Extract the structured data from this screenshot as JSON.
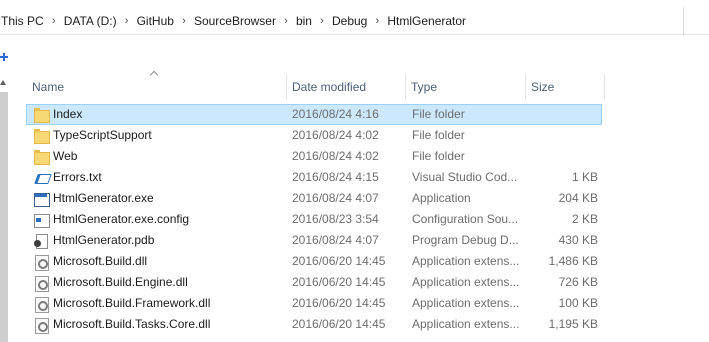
{
  "address_bar": {
    "crumbs": [
      "This PC",
      "DATA (D:)",
      "GitHub",
      "SourceBrowser",
      "bin",
      "Debug",
      "HtmlGenerator"
    ]
  },
  "columns": {
    "name": "Name",
    "date": "Date modified",
    "type": "Type",
    "size": "Size"
  },
  "files": [
    {
      "name": "Index",
      "date": "2016/08/24 4:16",
      "type": "File folder",
      "size": "",
      "icon": "folder-icon",
      "selected": true
    },
    {
      "name": "TypeScriptSupport",
      "date": "2016/08/24 4:02",
      "type": "File folder",
      "size": "",
      "icon": "folder-icon"
    },
    {
      "name": "Web",
      "date": "2016/08/24 4:02",
      "type": "File folder",
      "size": "",
      "icon": "folder-icon"
    },
    {
      "name": "Errors.txt",
      "date": "2016/08/24 4:15",
      "type": "Visual Studio Cod...",
      "size": "1 KB",
      "icon": "visual-studio-code-file-icon"
    },
    {
      "name": "HtmlGenerator.exe",
      "date": "2016/08/24 4:07",
      "type": "Application",
      "size": "204 KB",
      "icon": "application-icon"
    },
    {
      "name": "HtmlGenerator.exe.config",
      "date": "2016/08/23 3:54",
      "type": "Configuration Sou...",
      "size": "2 KB",
      "icon": "config-file-icon"
    },
    {
      "name": "HtmlGenerator.pdb",
      "date": "2016/08/24 4:07",
      "type": "Program Debug D...",
      "size": "430 KB",
      "icon": "debug-database-icon"
    },
    {
      "name": "Microsoft.Build.dll",
      "date": "2016/06/20 14:45",
      "type": "Application extens...",
      "size": "1,486 KB",
      "icon": "dll-icon"
    },
    {
      "name": "Microsoft.Build.Engine.dll",
      "date": "2016/06/20 14:45",
      "type": "Application extens...",
      "size": "726 KB",
      "icon": "dll-icon"
    },
    {
      "name": "Microsoft.Build.Framework.dll",
      "date": "2016/06/20 14:45",
      "type": "Application extens...",
      "size": "100 KB",
      "icon": "dll-icon"
    },
    {
      "name": "Microsoft.Build.Tasks.Core.dll",
      "date": "2016/06/20 14:45",
      "type": "Application extens...",
      "size": "1,195 KB",
      "icon": "dll-icon"
    }
  ],
  "colors": {
    "selection_bg": "#cce8ff",
    "selection_border": "#99d1ff",
    "header_text": "#4c607a",
    "folder": "#f8d775"
  }
}
